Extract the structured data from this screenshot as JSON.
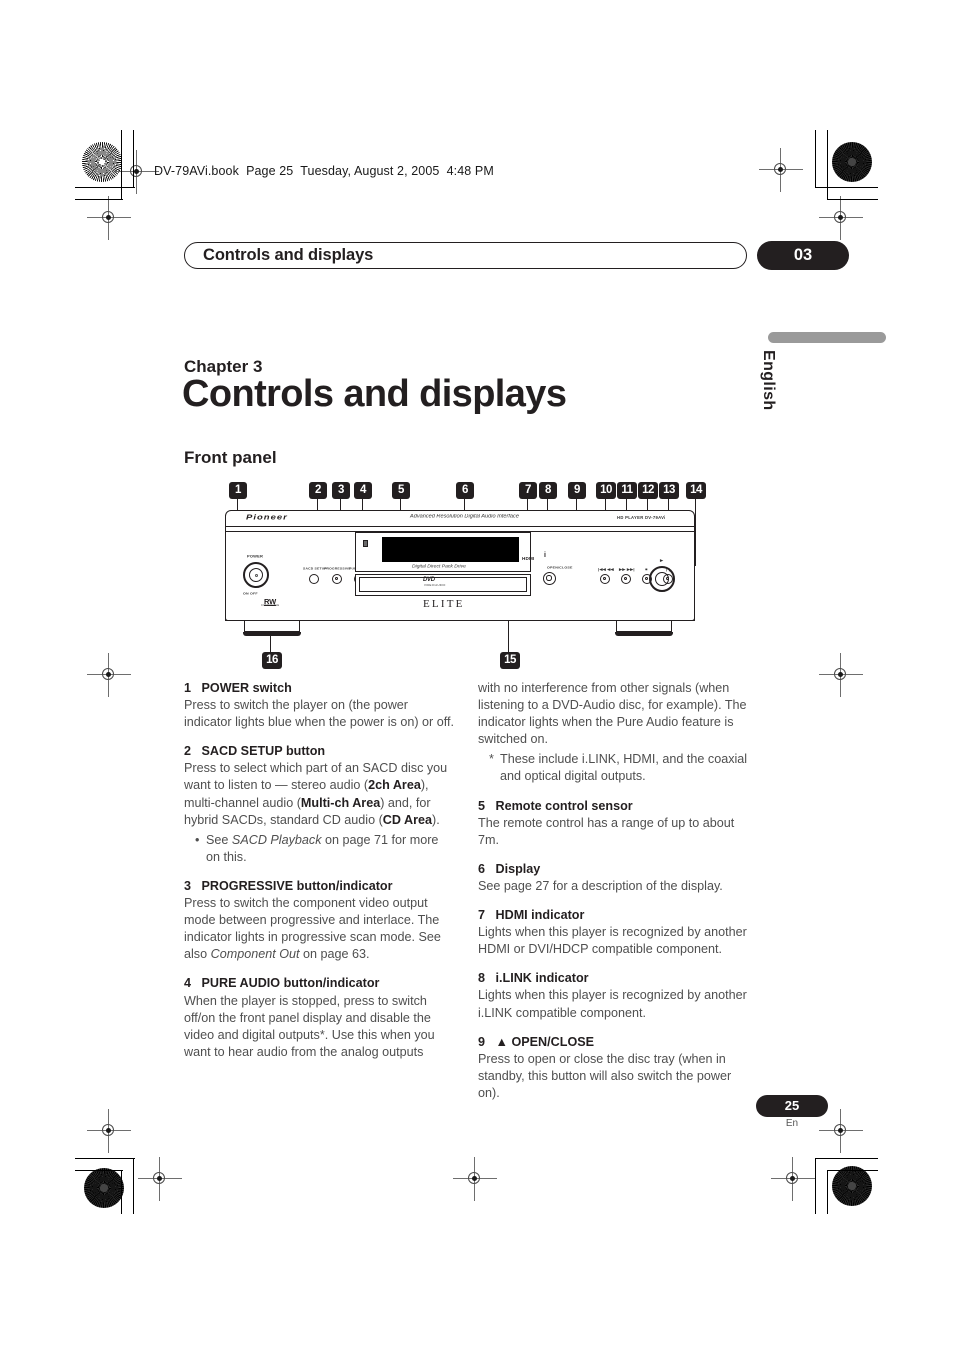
{
  "print_marks": {
    "book_line": "DV-79AVi.book  Page 25  Tuesday, August 2, 2005  4:48 PM"
  },
  "running_head": {
    "title": "Controls and displays",
    "chapter_badge": "03"
  },
  "language_tab": {
    "label": "English",
    "bar_color": "#9a9a9a"
  },
  "title_block": {
    "chapter_label": "Chapter 3",
    "title": "Controls and displays",
    "section": "Front panel"
  },
  "figure": {
    "callouts": [
      "1",
      "2",
      "3",
      "4",
      "5",
      "6",
      "7",
      "8",
      "9",
      "10",
      "11",
      "12",
      "13",
      "14",
      "15",
      "16"
    ],
    "device": {
      "brand": "Pioneer",
      "tagline": "Advanced Resolution Digital Audio Interface",
      "model_right": "HD PLAYER   DV-79AVi",
      "power_label": "POWER",
      "power_sublabel": "ON  OFF",
      "button_labels": [
        "SACD SETUP",
        "PROGRESSIVE",
        "PURE AUDIO"
      ],
      "display_caption": "Digital Direct Pack Drive",
      "indicator_hdmi": "HDMI",
      "indicator_ilink": "i",
      "disc_logo": "DVD",
      "disc_logo_sub": "VIDEO/AUDIO",
      "elite_mark": "ELITE",
      "rw_badge": "RW",
      "rw_sub": "COMPATIBLE",
      "open_close_label": "OPEN/CLOSE",
      "transport_labels": [
        "|◀◀ ◀◀",
        "▶▶ ▶▶|",
        "■",
        "| |"
      ],
      "play_label": "▶"
    }
  },
  "columns": {
    "left": [
      {
        "num": "1",
        "head": "POWER switch",
        "body_html": "Press to switch the player on (the power indicator lights blue when the power is on) or off."
      },
      {
        "num": "2",
        "head": "SACD SETUP button",
        "body_html": "Press to select which part of an SACD disc you want to listen to — stereo audio (<b class=\"em\">2ch Area</b>), multi-channel audio (<b class=\"em\">Multi-ch Area</b>) and, for hybrid SACDs, standard CD audio (<b class=\"em\">CD Area</b>).",
        "bullets": [
          {
            "mark": "•",
            "text_html": "See <i class=\"em\">SACD Playback</i> on page 71 for more on this."
          }
        ]
      },
      {
        "num": "3",
        "head": "PROGRESSIVE button/indicator",
        "body_html": "Press to switch the component video output mode between progressive and interlace. The indicator lights in progressive scan mode. See also <i class=\"em\">Component Out</i> on page 63."
      },
      {
        "num": "4",
        "head": "PURE AUDIO button/indicator",
        "body_html": "When the player is stopped, press to switch off/on the front panel display and disable the video and digital outputs*. Use this when you want to hear audio from the analog outputs"
      }
    ],
    "right": [
      {
        "num": "",
        "head": "",
        "body_html": "with no interference from other signals (when listening to a DVD-Audio disc, for example). The indicator lights when the Pure Audio feature is switched on.",
        "bullets": [
          {
            "mark": "*",
            "text_html": "These include i.LINK, HDMI, and the coaxial and optical digital outputs."
          }
        ]
      },
      {
        "num": "5",
        "head": "Remote control sensor",
        "body_html": "The remote control has a range of up to about 7m."
      },
      {
        "num": "6",
        "head": "Display",
        "body_html": "See page 27 for a description of the display."
      },
      {
        "num": "7",
        "head": "HDMI indicator",
        "body_html": "Lights when this player is recognized by another HDMI or DVI/HDCP compatible component."
      },
      {
        "num": "8",
        "head": "i.LINK indicator",
        "body_html": "Lights when this player is recognized by another i.LINK compatible component."
      },
      {
        "num": "9",
        "head": "▲ OPEN/CLOSE",
        "body_html": "Press to open or close the disc tray (when in standby, this button will also switch the power on)."
      }
    ]
  },
  "footer": {
    "page_number": "25",
    "language_code": "En"
  }
}
